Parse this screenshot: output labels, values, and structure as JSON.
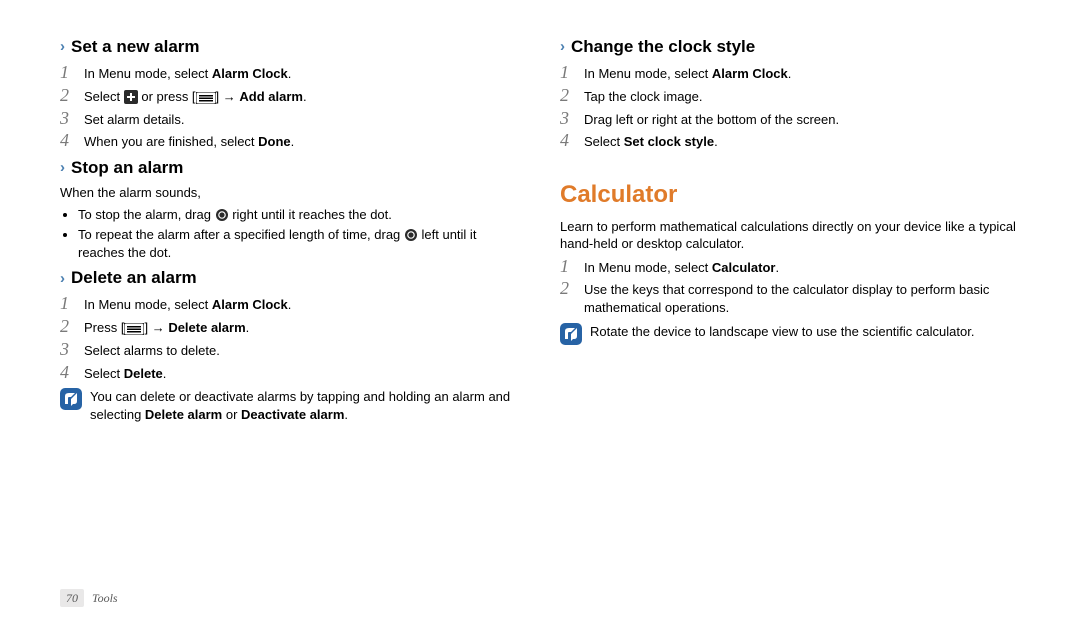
{
  "left": {
    "setAlarm": {
      "heading": "Set a new alarm",
      "steps": [
        {
          "pre": "In Menu mode, select ",
          "bold1": "Alarm Clock",
          "post1": "."
        },
        {
          "pre": "Select ",
          "icon": "plus",
          "mid": " or press [",
          "icon2": "menu",
          "mid2": "] → ",
          "bold1": "Add alarm",
          "post1": "."
        },
        {
          "pre": "Set alarm details."
        },
        {
          "pre": "When you are finished, select ",
          "bold1": "Done",
          "post1": "."
        }
      ]
    },
    "stopAlarm": {
      "heading": "Stop an alarm",
      "lead": "When the alarm sounds,",
      "bullets": [
        {
          "pre": "To stop the alarm, drag ",
          "icon": "ring",
          "post": " right until it reaches the dot."
        },
        {
          "pre": "To repeat the alarm after a specified length of time, drag ",
          "icon": "ring",
          "post": " left until it reaches the dot."
        }
      ]
    },
    "deleteAlarm": {
      "heading": "Delete an alarm",
      "steps": [
        {
          "pre": "In Menu mode, select ",
          "bold1": "Alarm Clock",
          "post1": "."
        },
        {
          "pre": "Press [",
          "icon": "menu",
          "mid": "] → ",
          "bold1": "Delete alarm",
          "post1": "."
        },
        {
          "pre": "Select alarms to delete."
        },
        {
          "pre": "Select ",
          "bold1": "Delete",
          "post1": "."
        }
      ],
      "note": {
        "pre": "You can delete or deactivate alarms by tapping and holding an alarm and selecting ",
        "bold1": "Delete alarm",
        "mid": " or ",
        "bold2": "Deactivate alarm",
        "post": "."
      }
    }
  },
  "right": {
    "changeStyle": {
      "heading": "Change the clock style",
      "steps": [
        {
          "pre": "In Menu mode, select ",
          "bold1": "Alarm Clock",
          "post1": "."
        },
        {
          "pre": "Tap the clock image."
        },
        {
          "pre": "Drag left or right at the bottom of the screen."
        },
        {
          "pre": "Select ",
          "bold1": "Set clock style",
          "post1": "."
        }
      ]
    },
    "calculator": {
      "heading": "Calculator",
      "lead": "Learn to perform mathematical calculations directly on your device like a typical hand-held or desktop calculator.",
      "steps": [
        {
          "pre": "In Menu mode, select ",
          "bold1": "Calculator",
          "post1": "."
        },
        {
          "pre": "Use the keys that correspond to the calculator display to perform basic mathematical operations."
        }
      ],
      "note": {
        "pre": "Rotate the device to landscape view to use the scientific calculator."
      }
    }
  },
  "footer": {
    "page": "70",
    "section": "Tools"
  },
  "nums": [
    "1",
    "2",
    "3",
    "4"
  ]
}
